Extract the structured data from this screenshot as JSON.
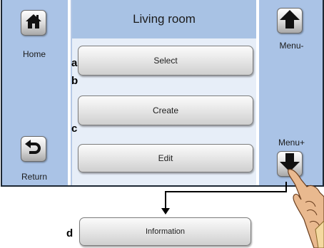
{
  "center": {
    "title": "Living room",
    "buttons": [
      "Select",
      "Create",
      "Edit"
    ]
  },
  "left_panel": {
    "home_label": "Home",
    "return_label": "Return"
  },
  "right_panel": {
    "menu_minus_label": "Menu-",
    "menu_plus_label": "Menu+"
  },
  "below": {
    "information_label": "Information"
  },
  "markers": [
    "a",
    "b",
    "c",
    "d"
  ],
  "icons": {
    "home": "home-icon",
    "return": "return-icon",
    "up": "arrow-up-icon",
    "down": "arrow-down-icon",
    "hand": "pointing-hand"
  },
  "colors": {
    "side_panel": "#aac3e6",
    "center_bg": "#e7eef8",
    "title_bar": "#a8c2e4"
  }
}
